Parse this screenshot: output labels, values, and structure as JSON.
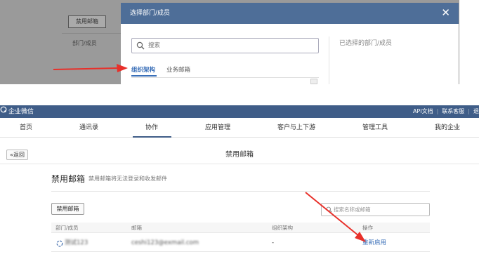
{
  "top": {
    "background": {
      "disable_button_label": "禁用邮箱",
      "field_label": "部门/成员"
    },
    "modal": {
      "title": "选择部门/成员",
      "close_icon": "close-icon",
      "search_placeholder": "搜索",
      "tabs": [
        {
          "label": "组织架构",
          "active": true
        },
        {
          "label": "业务邮箱",
          "active": false
        }
      ],
      "selected_title": "已选择的部门/成员"
    }
  },
  "app": {
    "logo_text": "企业微信",
    "top_links": [
      "API文档",
      "联系客服",
      "退"
    ],
    "nav": [
      {
        "label": "首页"
      },
      {
        "label": "通讯录"
      },
      {
        "label": "协作",
        "active": true
      },
      {
        "label": "应用管理"
      },
      {
        "label": "客户与上下游"
      },
      {
        "label": "管理工具"
      },
      {
        "label": "我的企业"
      }
    ],
    "back_label": "«返回",
    "page_heading": "禁用邮箱",
    "section_title": "禁用邮箱",
    "section_desc": "禁用邮箱将无法登录和收发邮件",
    "disable_button_label": "禁用邮箱",
    "search_placeholder": "搜索名称或邮箱",
    "table": {
      "columns": [
        "部门/成员",
        "邮箱",
        "组织架构",
        "操作"
      ],
      "rows": [
        {
          "member": "测试123",
          "email": "ceshi123@exmail.com",
          "org": "-",
          "action": "重新启用"
        }
      ]
    }
  },
  "colors": {
    "header_blue": "#4e6e98",
    "topbar_blue": "#3f5d88",
    "link_blue": "#3a6fb8",
    "arrow_red": "#e8302a"
  }
}
